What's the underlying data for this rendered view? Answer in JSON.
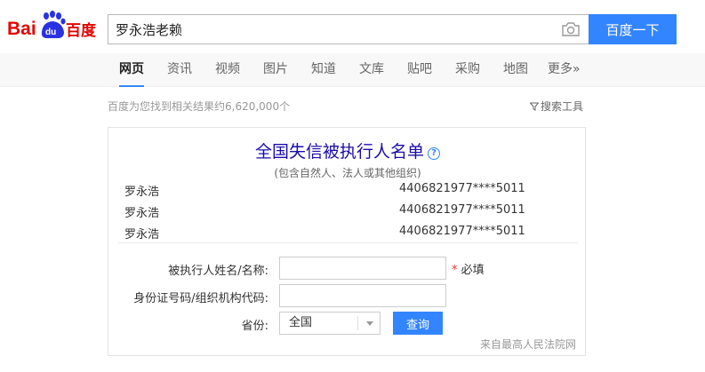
{
  "header": {
    "logo_text_left": "Bai",
    "logo_text_paw": "du",
    "logo_text_right": "百度",
    "search_value": "罗永浩老赖",
    "search_button": "百度一下",
    "camera_icon": "camera-icon"
  },
  "tabs": [
    {
      "label": "网页",
      "active": true
    },
    {
      "label": "资讯"
    },
    {
      "label": "视频"
    },
    {
      "label": "图片"
    },
    {
      "label": "知道"
    },
    {
      "label": "文库"
    },
    {
      "label": "贴吧"
    },
    {
      "label": "采购"
    },
    {
      "label": "地图"
    },
    {
      "label": "更多»"
    }
  ],
  "results": {
    "count_text": "百度为您找到相关结果约6,620,000个",
    "tools_label": "搜索工具"
  },
  "card": {
    "title": "全国失信被执行人名单",
    "help_icon": "?",
    "subtitle": "(包含自然人、法人或其他组织)",
    "rows": [
      {
        "name": "罗永浩",
        "id": "4406821977****5011"
      },
      {
        "name": "罗永浩",
        "id": "4406821977****5011"
      },
      {
        "name": "罗永浩",
        "id": "4406821977****5011"
      }
    ],
    "form": {
      "name_label": "被执行人姓名/名称:",
      "required_star": "*",
      "required_text": "必填",
      "id_label": "身份证号码/组织机构代码:",
      "province_label": "省份:",
      "province_value": "全国",
      "query_button": "查询"
    },
    "source": "来自最高人民法院网"
  },
  "colors": {
    "accent": "#3385ff",
    "logo_red": "#e10602",
    "logo_blue": "#2932e1",
    "title_blue": "#1a0dab"
  }
}
